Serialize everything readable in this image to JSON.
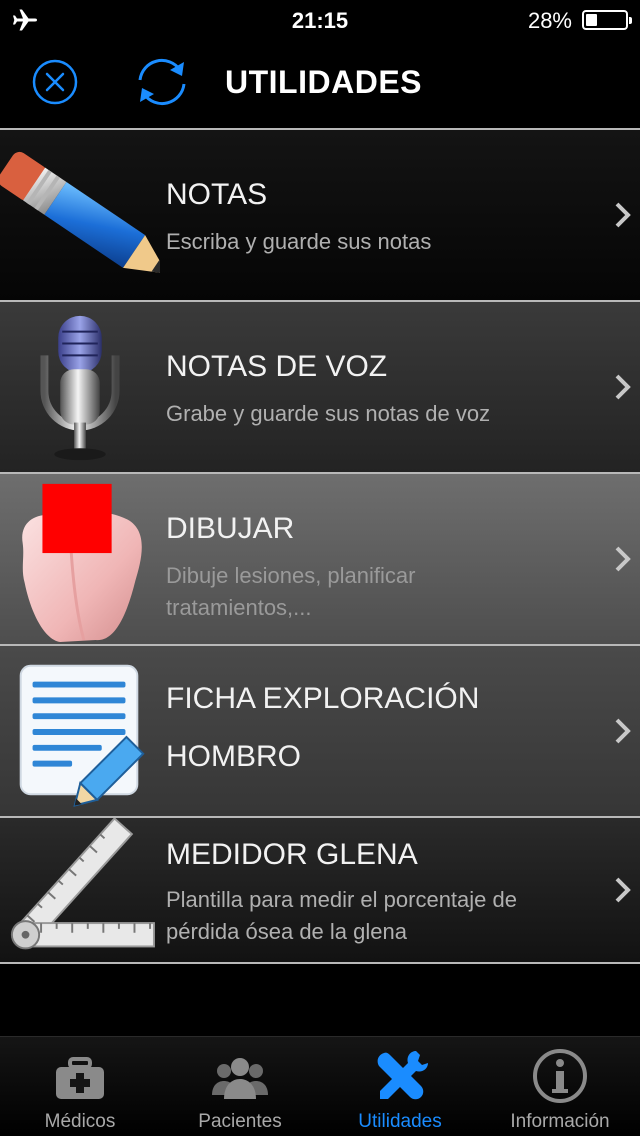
{
  "status_bar": {
    "time": "21:15",
    "battery": "28%",
    "battery_level": 0.28
  },
  "nav": {
    "title": "UTILIDADES"
  },
  "colors": {
    "accent": "#1a8cff",
    "tab_inactive": "#8a8a8a",
    "background": "#000000"
  },
  "items": [
    {
      "title": "NOTAS",
      "subtitle": "Escriba y guarde sus notas",
      "icon": "pencil-icon"
    },
    {
      "title": "NOTAS DE VOZ",
      "subtitle": "Grabe y guarde sus notas de voz",
      "icon": "microphone-icon"
    },
    {
      "title": "DIBUJAR",
      "subtitle_lines": [
        "Dibuje lesiones, planificar",
        "tratamientos,..."
      ],
      "icon": "tooth-icon"
    },
    {
      "title_lines": [
        "FICHA EXPLORACIÓN",
        "HOMBRO"
      ],
      "icon": "form-document-icon"
    },
    {
      "title": "MEDIDOR GLENA",
      "subtitle_lines": [
        "Plantilla para medir el porcentaje de",
        "pérdida ósea de la glena"
      ],
      "icon": "ruler-icon"
    }
  ],
  "tabs": [
    {
      "label": "Médicos",
      "icon": "medical-kit-icon",
      "active": false
    },
    {
      "label": "Pacientes",
      "icon": "people-icon",
      "active": false
    },
    {
      "label": "Utilidades",
      "icon": "tools-icon",
      "active": true
    },
    {
      "label": "Información",
      "icon": "info-icon",
      "active": false
    }
  ]
}
